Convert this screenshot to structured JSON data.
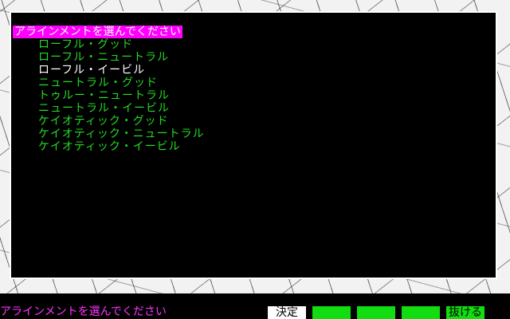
{
  "menu": {
    "title": "アラインメントを選んでください",
    "options": [
      "ローフル・グッド",
      "ローフル・ニュートラル",
      "ローフル・イービル",
      "ニュートラル・グッド",
      "トゥルー・ニュートラル",
      "ニュートラル・イービル",
      "ケイオティック・グッド",
      "ケイオティック・ニュートラル",
      "ケイオティック・イービル"
    ],
    "selected_index": 2
  },
  "status_bar": {
    "message": "アラインメントを選んでください",
    "commands": [
      "決定",
      "",
      "",
      "",
      "抜ける"
    ]
  },
  "colors": {
    "title_highlight": "#ff00ff",
    "option_text": "#22dd22",
    "selected_option_text": "#ffffff",
    "status_message": "#ff33ff",
    "command_active": "#ffffff",
    "command_key": "#11dd11"
  }
}
